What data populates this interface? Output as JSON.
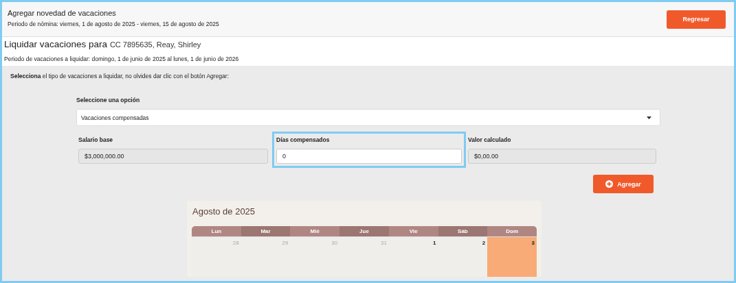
{
  "header": {
    "title": "Agregar novedad de vacaciones",
    "subtitle": "Periodo de nómina: viernes, 1 de agosto de 2025 - viernes, 15 de agosto de 2025",
    "back_button": "Regresar"
  },
  "employee": {
    "heading": "Liquidar vacaciones para",
    "id": "CC 7895635, Reay, Shirley",
    "period": "Periodo de vacaciones a liquidar: domingo, 1 de junio de 2025 al lunes, 1 de junio de 2026"
  },
  "instruction": "**Selecciona** el tipo de vacaciones a liquidar, no olvides dar clic con el botón Agregar:",
  "option": {
    "label": "Seleccione una opción",
    "value": "Vacaciones compensadas"
  },
  "fields": [
    {
      "label": "Salario base",
      "value": "$3,000,000.00",
      "disabled": true,
      "focused": false
    },
    {
      "label": "Días compensados",
      "value": "0",
      "disabled": false,
      "focused": true
    },
    {
      "label": "Valor calculado",
      "value": "$0,00.00",
      "disabled": true,
      "focused": false
    }
  ],
  "add_button": "Agregar",
  "calendar": {
    "title": "Agosto de 2025",
    "weekdays": [
      "Lun",
      "Mar",
      "Mié",
      "Jue",
      "Vie",
      "Sáb",
      "Dom"
    ],
    "weeks": [
      [
        {
          "day": "28",
          "outside": true,
          "highlighted": false
        },
        {
          "day": "29",
          "outside": true,
          "highlighted": false
        },
        {
          "day": "30",
          "outside": true,
          "highlighted": false
        },
        {
          "day": "31",
          "outside": true,
          "highlighted": false
        },
        {
          "day": "1",
          "outside": false,
          "highlighted": false
        },
        {
          "day": "2",
          "outside": false,
          "highlighted": false
        },
        {
          "day": "3",
          "outside": false,
          "highlighted": true
        }
      ]
    ]
  }
}
